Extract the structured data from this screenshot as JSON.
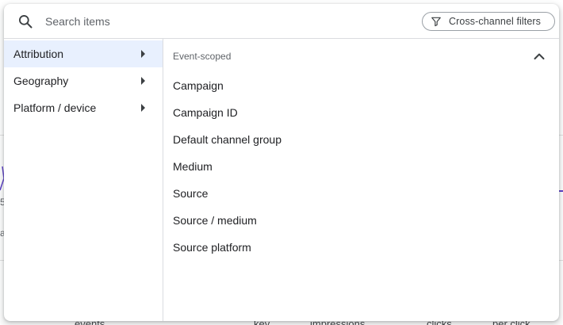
{
  "search": {
    "placeholder": "Search items",
    "icon": "search-icon"
  },
  "filter_chip": {
    "label": "Cross-channel filters",
    "icon": "filter-icon"
  },
  "categories": [
    {
      "label": "Attribution",
      "selected": true
    },
    {
      "label": "Geography",
      "selected": false
    },
    {
      "label": "Platform / device",
      "selected": false
    }
  ],
  "section": {
    "header": "Event-scoped",
    "expanded": true,
    "items": [
      "Campaign",
      "Campaign ID",
      "Default channel group",
      "Medium",
      "Source",
      "Source / medium",
      "Source platform"
    ]
  },
  "background": {
    "axis_fragment": "5",
    "side_fragment": "a",
    "column_headers": [
      "events",
      "key",
      "impressions",
      "clicks",
      "per click"
    ]
  },
  "colors": {
    "selected_bg": "#e8f0fe",
    "divider": "#dadce0",
    "chart_line": "#5b3ec8"
  }
}
